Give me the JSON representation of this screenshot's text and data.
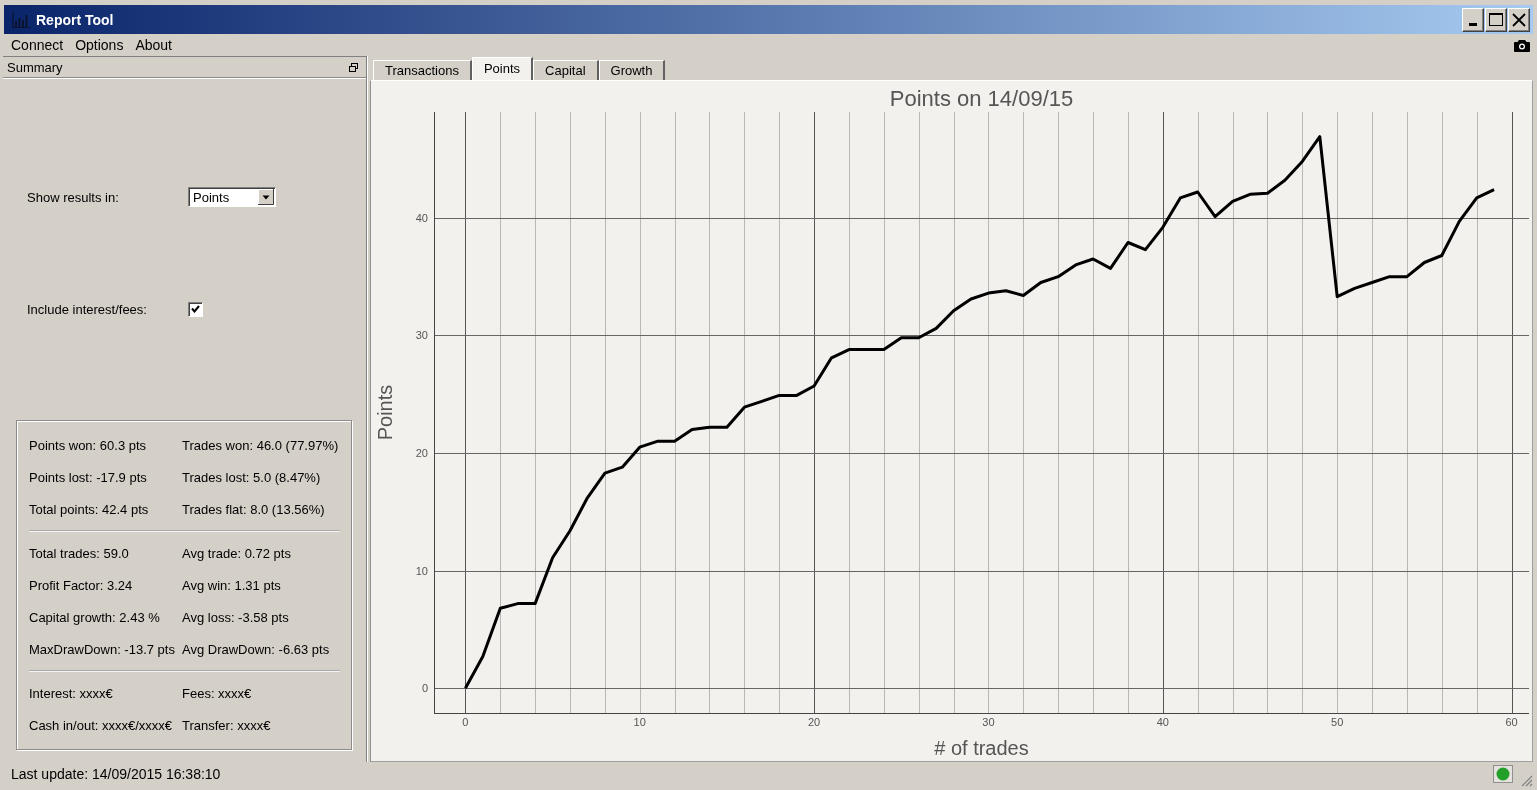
{
  "window": {
    "title": "Report Tool"
  },
  "menu": {
    "items": [
      "Connect",
      "Options",
      "About"
    ]
  },
  "summary": {
    "title": "Summary",
    "controls": [
      {
        "kind": "dropdown",
        "label": "Show results in:",
        "value": "Points"
      },
      {
        "kind": "checkbox",
        "label": "Include interest/fees:",
        "checked": true
      }
    ],
    "stat_groups": [
      [
        [
          "Points won: 60.3 pts",
          "Trades won: 46.0 (77.97%)"
        ],
        [
          "Points lost: -17.9 pts",
          "Trades lost: 5.0 (8.47%)"
        ],
        [
          "Total points: 42.4 pts",
          "Trades flat: 8.0 (13.56%)"
        ]
      ],
      [
        [
          "Total trades: 59.0",
          "Avg trade: 0.72 pts"
        ],
        [
          "Profit Factor: 3.24",
          "Avg win: 1.31 pts"
        ],
        [
          "Capital growth: 2.43 %",
          "Avg loss: -3.58 pts"
        ],
        [
          "MaxDrawDown: -13.7 pts",
          "Avg DrawDown: -6.63 pts"
        ]
      ],
      [
        [
          "Interest: xxxx€",
          "Fees: xxxx€"
        ],
        [
          "Cash in/out: xxxx€/xxxx€",
          "Transfer: xxxx€"
        ]
      ]
    ]
  },
  "tabs": [
    {
      "label": "Transactions",
      "selected": false
    },
    {
      "label": "Points",
      "selected": true
    },
    {
      "label": "Capital",
      "selected": false
    },
    {
      "label": "Growth",
      "selected": false
    }
  ],
  "chart": {
    "chart_data": {
      "type": "line",
      "title": "Points on 14/09/15",
      "xlabel": "# of trades",
      "ylabel": "Points",
      "x": [
        0,
        1,
        2,
        3,
        4,
        5,
        6,
        7,
        8,
        9,
        10,
        11,
        12,
        13,
        14,
        15,
        16,
        17,
        18,
        19,
        20,
        21,
        22,
        23,
        24,
        25,
        26,
        27,
        28,
        29,
        30,
        31,
        32,
        33,
        34,
        35,
        36,
        37,
        38,
        39,
        40,
        41,
        42,
        43,
        44,
        45,
        46,
        47,
        48,
        49,
        50,
        51,
        52,
        53,
        54,
        55,
        56,
        57,
        58,
        59
      ],
      "series": [
        {
          "color": "#000000",
          "values": [
            0,
            2.7,
            6.8,
            7.2,
            7.2,
            11.1,
            13.4,
            16.2,
            18.3,
            18.8,
            20.5,
            21.0,
            21.0,
            22.0,
            22.2,
            22.2,
            23.9,
            24.4,
            24.9,
            24.9,
            25.7,
            28.1,
            28.8,
            28.8,
            28.8,
            29.8,
            29.8,
            30.6,
            32.1,
            33.1,
            33.6,
            33.8,
            33.4,
            34.5,
            35.0,
            36.0,
            36.5,
            35.7,
            37.9,
            37.3,
            39.2,
            41.7,
            42.2,
            40.1,
            41.4,
            42.0,
            42.1,
            43.2,
            44.8,
            46.9,
            33.3,
            34.0,
            34.5,
            35.0,
            35.0,
            36.2,
            36.8,
            39.7,
            41.7,
            42.4
          ]
        }
      ],
      "xlim": [
        -1.8,
        61
      ],
      "ylim": [
        -2.1,
        49
      ],
      "xticks": [
        0,
        10,
        20,
        30,
        40,
        50,
        60
      ],
      "yticks": [
        0,
        10,
        20,
        30,
        40
      ],
      "grid": true
    }
  },
  "status_bar": {
    "text": "Last update: 14/09/2015 16:38:10",
    "connected": true
  }
}
